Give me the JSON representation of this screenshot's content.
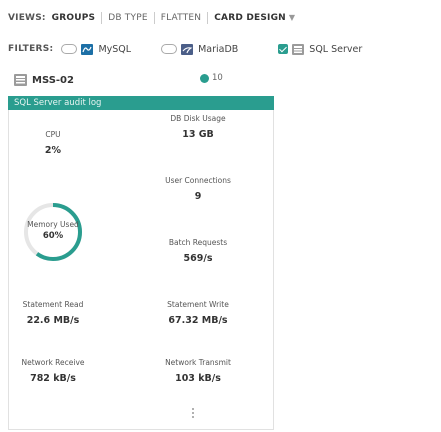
{
  "views": {
    "label": "VIEWS:",
    "items": [
      {
        "label": "GROUPS",
        "active": true
      },
      {
        "label": "DB TYPE",
        "active": false
      },
      {
        "label": "FLATTEN",
        "active": false
      },
      {
        "label": "CARD DESIGN",
        "active": false
      }
    ]
  },
  "filters": {
    "label": "FILTERS:",
    "items": [
      {
        "label": "MySQL",
        "checked": false,
        "icon": "mysql-icon"
      },
      {
        "label": "MariaDB",
        "checked": false,
        "icon": "mariadb-icon"
      },
      {
        "label": "SQL Server",
        "checked": true,
        "icon": "sqlserver-icon"
      }
    ]
  },
  "card": {
    "server_name": "MSS-02",
    "count": "10",
    "banner": "SQL Server audit log",
    "metrics": {
      "db_disk_usage": {
        "label": "DB Disk Usage",
        "value": "13 GB"
      },
      "cpu": {
        "label": "CPU",
        "value": "2%"
      },
      "user_connections": {
        "label": "User Connections",
        "value": "9"
      },
      "memory_used": {
        "label": "Memory Used",
        "value": "60%",
        "fraction": 0.6
      },
      "batch_requests": {
        "label": "Batch Requests",
        "value": "569/s"
      },
      "statement_read": {
        "label": "Statement Read",
        "value": "22.6 MB/s"
      },
      "statement_write": {
        "label": "Statement Write",
        "value": "67.32 MB/s"
      },
      "network_receive": {
        "label": "Network Receive",
        "value": "782 kB/s"
      },
      "network_transmit": {
        "label": "Network Transmit",
        "value": "103 kB/s"
      }
    }
  },
  "colors": {
    "accent": "#2a9d8f",
    "mysql": "#1c6fa6",
    "mariadb": "#4b5e88",
    "sqlserver": "#9b9b9b"
  }
}
